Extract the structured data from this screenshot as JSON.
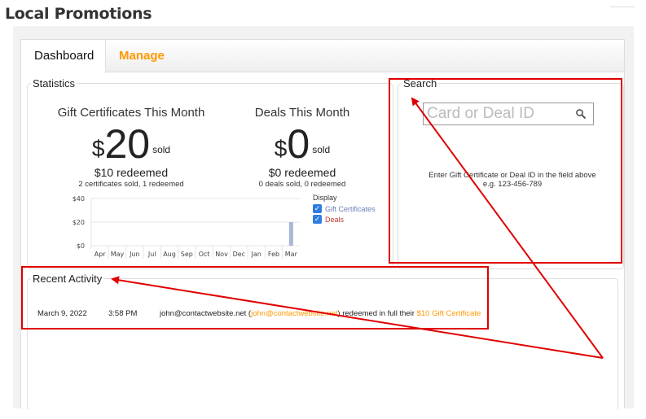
{
  "page": {
    "title": "Local Promotions"
  },
  "tabs": [
    {
      "label": "Dashboard",
      "active": true
    },
    {
      "label": "Manage",
      "active": false
    }
  ],
  "statistics": {
    "legend": "Statistics",
    "gift": {
      "heading": "Gift Certificates This Month",
      "currency": "$",
      "amount": "20",
      "sold_label": "sold",
      "redeemed": "$10 redeemed",
      "summary": "2 certificates sold, 1 redeemed"
    },
    "deals": {
      "heading": "Deals This Month",
      "currency": "$",
      "amount": "0",
      "sold_label": "sold",
      "redeemed": "$0 redeemed",
      "summary": "0 deals sold, 0 redeemed"
    },
    "display": {
      "title": "Display",
      "options": [
        {
          "label": "Gift Certificates",
          "checked": true,
          "color": "#6b7fb8"
        },
        {
          "label": "Deals",
          "checked": true,
          "color": "#c0392b"
        }
      ]
    }
  },
  "chart_data": {
    "type": "bar",
    "categories": [
      "Apr",
      "May",
      "Jun",
      "Jul",
      "Aug",
      "Sep",
      "Oct",
      "Nov",
      "Dec",
      "Jan",
      "Feb",
      "Mar"
    ],
    "series": [
      {
        "name": "Gift Certificates",
        "values": [
          0,
          0,
          0,
          0,
          0,
          0,
          0,
          0,
          0,
          0,
          0,
          20
        ],
        "color": "#a9b6d6"
      },
      {
        "name": "Deals",
        "values": [
          0,
          0,
          0,
          0,
          0,
          0,
          0,
          0,
          0,
          0,
          0,
          0
        ],
        "color": "#c0392b"
      }
    ],
    "y_ticks": [
      "$0",
      "$20",
      "$40"
    ],
    "ylim": [
      0,
      40
    ],
    "grid": true
  },
  "search": {
    "legend": "Search",
    "placeholder": "Card or Deal ID",
    "hint_line1": "Enter Gift Certificate or Deal ID in the field above",
    "hint_line2": "e.g. 123-456-789"
  },
  "recent_activity": {
    "legend": "Recent Activity",
    "rows": [
      {
        "date": "March 9, 2022",
        "time": "3:58 PM",
        "email": "john@contactwebsite.net",
        "paren_open": " (",
        "link_email": "john@contactwebsite.net",
        "paren_close_text": ") redeemed in full their ",
        "item_link": "$10 Gift Certificate"
      }
    ]
  },
  "annotation_color": "#e00000"
}
